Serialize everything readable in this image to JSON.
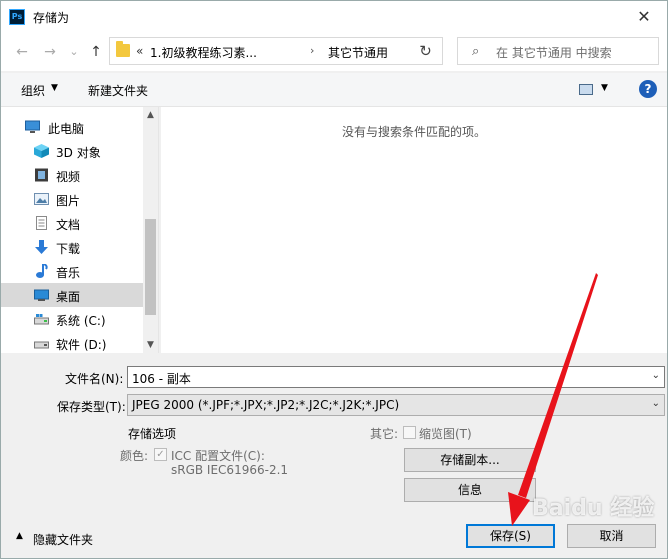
{
  "window": {
    "title": "存储为",
    "app_icon_text": "Ps",
    "close_glyph": "✕"
  },
  "nav": {
    "back_glyph": "←",
    "forward_glyph": "→",
    "history_glyph": "⌄",
    "up_glyph": "↑",
    "address": {
      "prefix": "«",
      "segment1": "1.初级教程练习素...",
      "arrow": "›",
      "segment2": "其它节通用",
      "dropdown_glyph": "⌄"
    },
    "refresh_glyph": "↻",
    "search": {
      "icon": "⌕",
      "placeholder": "在 其它节通用 中搜索"
    }
  },
  "toolbar": {
    "organize": "组织",
    "organize_dd": "▼",
    "new_folder": "新建文件夹",
    "view_dd": "▼",
    "help": "?"
  },
  "sidebar": {
    "items": [
      {
        "label": "此电脑",
        "icon": "pc-icon"
      },
      {
        "label": "3D 对象",
        "icon": "3d-objects-icon"
      },
      {
        "label": "视频",
        "icon": "video-icon"
      },
      {
        "label": "图片",
        "icon": "pictures-icon"
      },
      {
        "label": "文档",
        "icon": "documents-icon"
      },
      {
        "label": "下载",
        "icon": "downloads-icon"
      },
      {
        "label": "音乐",
        "icon": "music-icon"
      },
      {
        "label": "桌面",
        "icon": "desktop-icon"
      },
      {
        "label": "系统 (C:)",
        "icon": "drive-c-icon"
      },
      {
        "label": "软件 (D:)",
        "icon": "drive-d-icon"
      }
    ],
    "selected": "桌面",
    "scroll_up": "▲",
    "scroll_down": "▼"
  },
  "content": {
    "empty_message": "没有与搜索条件匹配的项。"
  },
  "form": {
    "filename_label": "文件名(N):",
    "filename_value": "106 - 副本",
    "filetype_label": "保存类型(T):",
    "filetype_value": "JPEG 2000 (*.JPF;*.JPX;*.JP2;*.J2C;*.J2K;*.JPC)",
    "dd_glyph": "⌄",
    "save_options_title": "存储选项",
    "color_label": "颜色:",
    "icc_label": "ICC 配置文件(C):",
    "icc_checked": true,
    "icc_profile": "sRGB IEC61966-2.1",
    "other_label": "其它:",
    "thumbnail_label": "缩览图(T)",
    "thumbnail_checked": false,
    "save_copy_button": "存储副本...",
    "info_button": "信息"
  },
  "footer": {
    "hide_folders_glyph": "▲",
    "hide_folders": "隐藏文件夹",
    "save": "保存(S)",
    "cancel": "取消"
  },
  "colors": {
    "accent": "#0078d7",
    "annotation_arrow": "#e8131b",
    "folder": "#f3c83e"
  },
  "watermark": "Baidu 经验"
}
